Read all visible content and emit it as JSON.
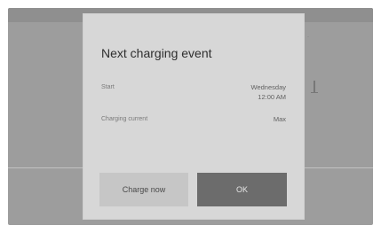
{
  "dialog": {
    "title": "Next charging event",
    "start": {
      "label": "Start",
      "day": "Wednesday",
      "time": "12:00 AM"
    },
    "charging_current": {
      "label": "Charging current",
      "value": "Max"
    },
    "buttons": {
      "charge_now": "Charge now",
      "ok": "OK"
    }
  }
}
